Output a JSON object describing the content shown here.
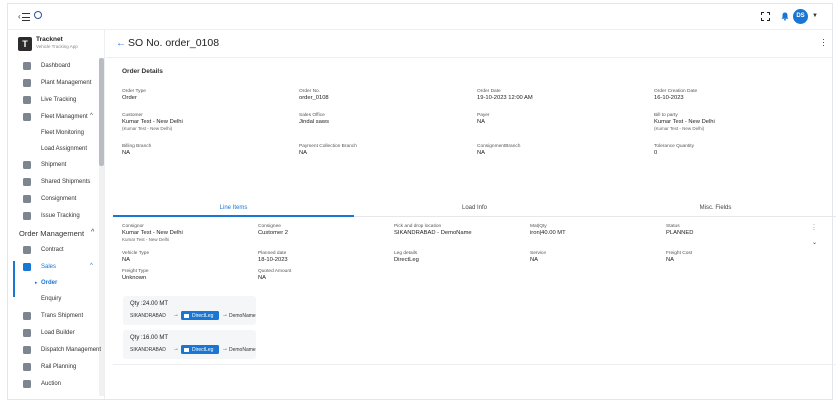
{
  "header": {
    "fullscreen_icon": "fullscreen-icon",
    "notification_icon": "bell-icon",
    "avatar_initials": "DS"
  },
  "brand": {
    "logo_letter": "T",
    "name": "Tracknet",
    "subtitle": "Vehicle Tracking App"
  },
  "sidebar": {
    "items": [
      {
        "label": "Dashboard",
        "icon": "dashboard-icon"
      },
      {
        "label": "Plant Management",
        "icon": "plant-icon"
      },
      {
        "label": "Live Tracking",
        "icon": "truck-icon"
      },
      {
        "label": "Fleet Managment",
        "icon": "fleet-icon"
      },
      {
        "label": "Fleet Monitoring"
      },
      {
        "label": "Load Assignment"
      },
      {
        "label": "Shipment",
        "icon": "shipment-icon"
      },
      {
        "label": "Shared Shipments",
        "icon": "shared-icon"
      },
      {
        "label": "Consignment",
        "icon": "box-icon"
      },
      {
        "label": "Issue Tracking",
        "icon": "pin-icon"
      }
    ],
    "section_order": "Order Management",
    "order_items": [
      {
        "label": "Contract",
        "icon": "contract-icon"
      },
      {
        "label": "Sales",
        "icon": "sales-icon"
      },
      {
        "label": "Order"
      },
      {
        "label": "Enquiry"
      },
      {
        "label": "Trans Shipment",
        "icon": "trans-icon"
      },
      {
        "label": "Load Builder",
        "icon": "load-icon"
      },
      {
        "label": "Dispatch Management",
        "icon": "dispatch-icon"
      },
      {
        "label": "Rail Planning",
        "icon": "rail-icon"
      },
      {
        "label": "Auction",
        "icon": "auction-icon"
      }
    ]
  },
  "page": {
    "title": "SO No. order_0108"
  },
  "order_details": {
    "title": "Order Details",
    "fields": [
      {
        "label": "Order Type",
        "value": "Order",
        "sub": ""
      },
      {
        "label": "Order No.",
        "value": "order_0108",
        "sub": ""
      },
      {
        "label": "Order Date",
        "value": "19-10-2023 12:00 AM",
        "sub": ""
      },
      {
        "label": "Order Creation Date",
        "value": "16-10-2023",
        "sub": ""
      },
      {
        "label": "Customer",
        "value": "Kumar Test - New Delhi",
        "sub": "(Kumar Test - New Delhi)"
      },
      {
        "label": "Sales Office",
        "value": "Jindal saws",
        "sub": ""
      },
      {
        "label": "Payer",
        "value": "NA",
        "sub": ""
      },
      {
        "label": "Bill to party",
        "value": "Kumar Test - New Delhi",
        "sub": "(Kumar Test - New Delhi)"
      },
      {
        "label": "Billing Branch",
        "value": "NA",
        "sub": ""
      },
      {
        "label": "Payment Collection Branch",
        "value": "NA",
        "sub": ""
      },
      {
        "label": "ConsignmentBranch",
        "value": "NA",
        "sub": ""
      },
      {
        "label": "Tolerance Quantity",
        "value": "0",
        "sub": ""
      }
    ]
  },
  "tabs": [
    "Line Items",
    "Load Info",
    "Misc. Fields"
  ],
  "line_item": {
    "fields": [
      {
        "label": "Consignor",
        "value": "Kumar Test - New Delhi",
        "sub": "Kumar Test - New Delhi"
      },
      {
        "label": "Consignee",
        "value": "Customer 2",
        "sub": ""
      },
      {
        "label": "Pick and drop location",
        "value": "SIKANDRABAD - DemoName",
        "sub": ""
      },
      {
        "label": "Mat|Qty",
        "value": "iron|40.00 MT",
        "sub": ""
      },
      {
        "label": "Status",
        "value": "PLANNED",
        "sub": ""
      },
      {
        "label": "Vehicle Type",
        "value": "NA",
        "sub": ""
      },
      {
        "label": "Planned date",
        "value": "18-10-2023",
        "sub": ""
      },
      {
        "label": "Leg details",
        "value": "DirectLeg",
        "sub": ""
      },
      {
        "label": "Service",
        "value": "NA",
        "sub": ""
      },
      {
        "label": "Freight Cost",
        "value": "NA",
        "sub": ""
      },
      {
        "label": "Freight Type",
        "value": "Unknown",
        "sub": ""
      },
      {
        "label": "Quoted Amount",
        "value": "NA",
        "sub": ""
      }
    ],
    "legs": [
      {
        "qty": "Qty :24.00 MT",
        "from": "SIKANDRABAD",
        "leg": "DirectLeg",
        "to": "DemoName"
      },
      {
        "qty": "Qty :16.00 MT",
        "from": "SIKANDRABAD",
        "leg": "DirectLeg",
        "to": "DemoName"
      }
    ]
  },
  "colors": {
    "accent": "#1976d2",
    "sidebar_icon": "#7d8590"
  }
}
